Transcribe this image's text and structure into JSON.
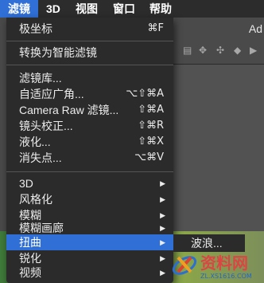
{
  "menubar": {
    "items": [
      {
        "label": "滤镜"
      },
      {
        "label": "3D"
      },
      {
        "label": "视图"
      },
      {
        "label": "窗口"
      },
      {
        "label": "帮助"
      }
    ]
  },
  "background": {
    "toolbar_text": "Ad"
  },
  "filter_menu": {
    "items": [
      {
        "label": "极坐标",
        "shortcut": "⌘F"
      },
      {
        "label": "转换为智能滤镜",
        "shortcut": ""
      },
      {
        "label": "滤镜库...",
        "shortcut": ""
      },
      {
        "label": "自适应广角...",
        "shortcut": "⌥⇧⌘A"
      },
      {
        "label": "Camera Raw 滤镜...",
        "shortcut": "⇧⌘A"
      },
      {
        "label": "镜头校正...",
        "shortcut": "⇧⌘R"
      },
      {
        "label": "液化...",
        "shortcut": "⇧⌘X"
      },
      {
        "label": "消失点...",
        "shortcut": "⌥⌘V"
      },
      {
        "label": "3D",
        "submenu": true
      },
      {
        "label": "风格化",
        "submenu": true
      },
      {
        "label": "模糊",
        "submenu": true
      },
      {
        "label": "模糊画廊",
        "submenu": true
      },
      {
        "label": "扭曲",
        "submenu": true,
        "highlighted": true
      },
      {
        "label": "锐化",
        "submenu": true
      },
      {
        "label": "视频",
        "submenu": true
      }
    ]
  },
  "submenu": {
    "items": [
      {
        "label": "波浪..."
      }
    ]
  },
  "watermark": {
    "text": "资料网",
    "url": "ZL.XS1616.COM"
  }
}
